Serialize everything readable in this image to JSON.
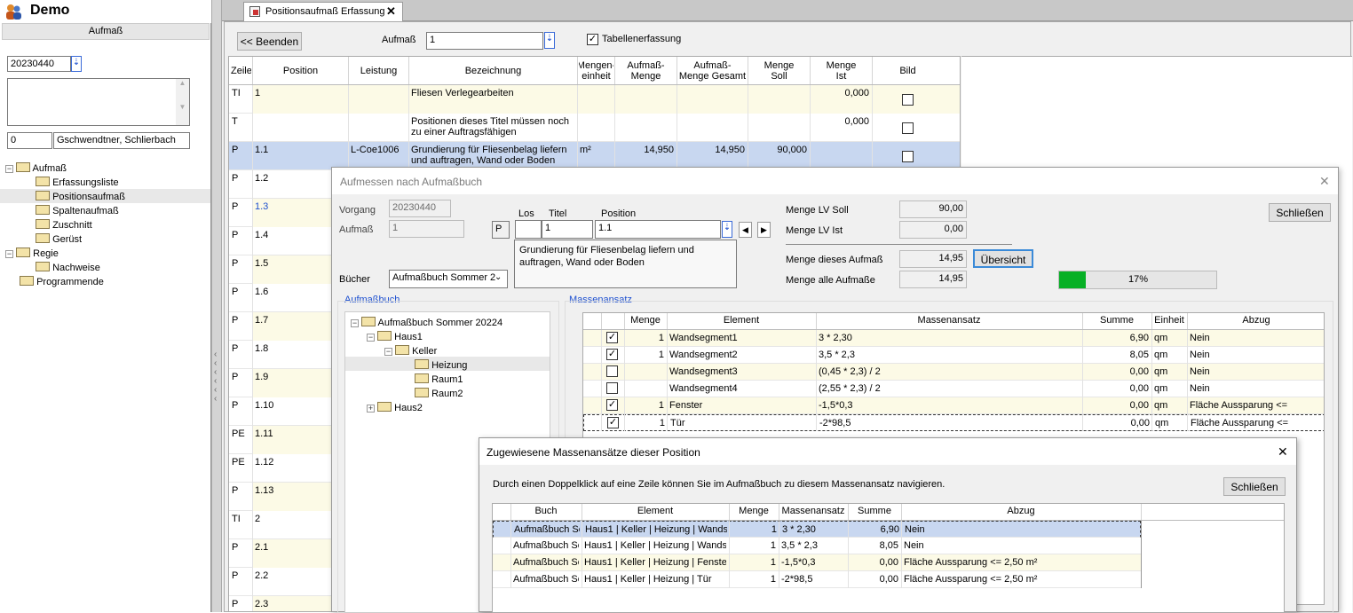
{
  "app": {
    "title": "Demo",
    "section": "Aufmaß"
  },
  "sidebar": {
    "number": "20230440",
    "count": "0",
    "customer": "Gschwendtner, Schlierbach",
    "tree": [
      "Aufmaß",
      "Erfassungsliste",
      "Positionsaufmaß",
      "Spaltenaufmaß",
      "Zuschnitt",
      "Gerüst",
      "Regie",
      "Nachweise",
      "Programmende"
    ]
  },
  "tab": {
    "label": "Positionsaufmaß Erfassung",
    "close": "✕"
  },
  "toolbar": {
    "beenden": "<< Beenden",
    "aufmass_label": "Aufmaß",
    "aufmass_value": "1",
    "tabelle_label": "Tabellenerfassung"
  },
  "table": {
    "headers": [
      "Zeile",
      "Position",
      "Leistung",
      "Bezeichnung",
      "Mengen-\neinheit",
      "Aufmaß-\nMenge",
      "Aufmaß-\nMenge Gesamt",
      "Menge\nSoll",
      "Menge\nIst",
      "Bild"
    ],
    "rows": [
      {
        "z": "TI",
        "p": "1",
        "l": "",
        "b": "Fliesen Verlegearbeiten",
        "e": "",
        "am": "",
        "ag": "",
        "ms": "",
        "mi": "0,000"
      },
      {
        "z": "T",
        "p": "",
        "l": "",
        "b": "Positionen dieses Titel müssen noch zu einer Auftragsfähigen",
        "e": "",
        "am": "",
        "ag": "",
        "ms": "",
        "mi": "0,000"
      },
      {
        "z": "P",
        "p": "1.1",
        "l": "L-Coe1006",
        "b": "Grundierung für Fliesenbelag liefern und auftragen, Wand oder Boden",
        "e": "m²",
        "am": "14,950",
        "ag": "14,950",
        "ms": "90,000",
        "mi": ""
      },
      {
        "z": "P",
        "p": "1.2"
      },
      {
        "z": "P",
        "p": "1.3"
      },
      {
        "z": "P",
        "p": "1.4"
      },
      {
        "z": "P",
        "p": "1.5"
      },
      {
        "z": "P",
        "p": "1.6"
      },
      {
        "z": "P",
        "p": "1.7"
      },
      {
        "z": "P",
        "p": "1.8"
      },
      {
        "z": "P",
        "p": "1.9"
      },
      {
        "z": "P",
        "p": "1.10"
      },
      {
        "z": "PE",
        "p": "1.11"
      },
      {
        "z": "PE",
        "p": "1.12"
      },
      {
        "z": "P",
        "p": "1.13"
      },
      {
        "z": "TI",
        "p": "2"
      },
      {
        "z": "P",
        "p": "2.1"
      },
      {
        "z": "P",
        "p": "2.2"
      },
      {
        "z": "P",
        "p": "2.3"
      }
    ]
  },
  "dialog1": {
    "title": "Aufmessen nach Aufmaßbuch",
    "close": "✕",
    "vorgang_label": "Vorgang",
    "vorgang": "20230440",
    "aufmass_label": "Aufmaß",
    "aufmass": "1",
    "los_label": "Los",
    "titel_label": "Titel",
    "position_label": "Position",
    "p": "P",
    "titel": "1",
    "position": "1.1",
    "desc": "Grundierung für Fliesenbelag liefern und auftragen, Wand oder Boden",
    "buecher_label": "Bücher",
    "buecher": "Aufmaßbuch Sommer 2",
    "soll_label": "Menge LV Soll",
    "soll": "90,00",
    "ist_label": "Menge LV Ist",
    "ist": "0,00",
    "dieses_label": "Menge dieses Aufmaß",
    "dieses": "14,95",
    "alle_label": "Menge alle Aufmaße",
    "alle": "14,95",
    "uebersicht": "Übersicht",
    "schliessen": "Schließen",
    "progress_label": "17%",
    "progress": 0.17,
    "aufmassbuch_label": "Aufmaßbuch",
    "massenansatz_label": "Massenansatz",
    "tree": [
      "Aufmaßbuch Sommer 20224",
      "Haus1",
      "Keller",
      "Heizung",
      "Raum1",
      "Raum2",
      "Haus2"
    ],
    "mheaders": [
      "Menge",
      "Element",
      "Massenansatz",
      "Summe",
      "Einheit",
      "Abzug"
    ],
    "mrows": [
      {
        "c": true,
        "m": "1",
        "e": "Wandsegment1",
        "f": "3 * 2,30",
        "s": "6,90",
        "u": "qm",
        "a": "Nein"
      },
      {
        "c": true,
        "m": "1",
        "e": "Wandsegment2",
        "f": "3,5 * 2,3",
        "s": "8,05",
        "u": "qm",
        "a": "Nein"
      },
      {
        "c": false,
        "m": "",
        "e": "Wandsegment3",
        "f": "(0,45 * 2,3) / 2",
        "s": "0,00",
        "u": "qm",
        "a": "Nein"
      },
      {
        "c": false,
        "m": "",
        "e": "Wandsegment4",
        "f": "(2,55 * 2,3) / 2",
        "s": "0,00",
        "u": "qm",
        "a": "Nein"
      },
      {
        "c": true,
        "m": "1",
        "e": "Fenster",
        "f": "-1,5*0,3",
        "s": "0,00",
        "u": "qm",
        "a": "Fläche Aussparung <="
      },
      {
        "c": true,
        "m": "1",
        "e": "Tür",
        "f": "-2*98,5",
        "s": "0,00",
        "u": "qm",
        "a": "Fläche Aussparung <="
      }
    ]
  },
  "dialog2": {
    "title": "Zugewiesene Massenansätze dieser Position",
    "close": "✕",
    "hint": "Durch einen Doppelklick auf eine Zeile können Sie im Aufmaßbuch zu diesem Massenansatz navigieren.",
    "schliessen": "Schließen",
    "headers": [
      "Buch",
      "Element",
      "Menge",
      "Massenansatz",
      "Summe",
      "Abzug"
    ],
    "rows": [
      {
        "b": "Aufmaßbuch Sc",
        "e": "Haus1 | Keller | Heizung | Wands",
        "m": "1",
        "f": "3 * 2,30",
        "s": "6,90",
        "a": "Nein"
      },
      {
        "b": "Aufmaßbuch Sc",
        "e": "Haus1 | Keller | Heizung | Wands",
        "m": "1",
        "f": "3,5 * 2,3",
        "s": "8,05",
        "a": "Nein"
      },
      {
        "b": "Aufmaßbuch Sc",
        "e": "Haus1 | Keller | Heizung | Fenste",
        "m": "1",
        "f": "-1,5*0,3",
        "s": "0,00",
        "a": "Fläche Aussparung <= 2,50 m²"
      },
      {
        "b": "Aufmaßbuch Sc",
        "e": "Haus1 | Keller | Heizung | Tür",
        "m": "1",
        "f": "-2*98,5",
        "s": "0,00",
        "a": "Fläche Aussparung <= 2,50 m²"
      }
    ]
  }
}
